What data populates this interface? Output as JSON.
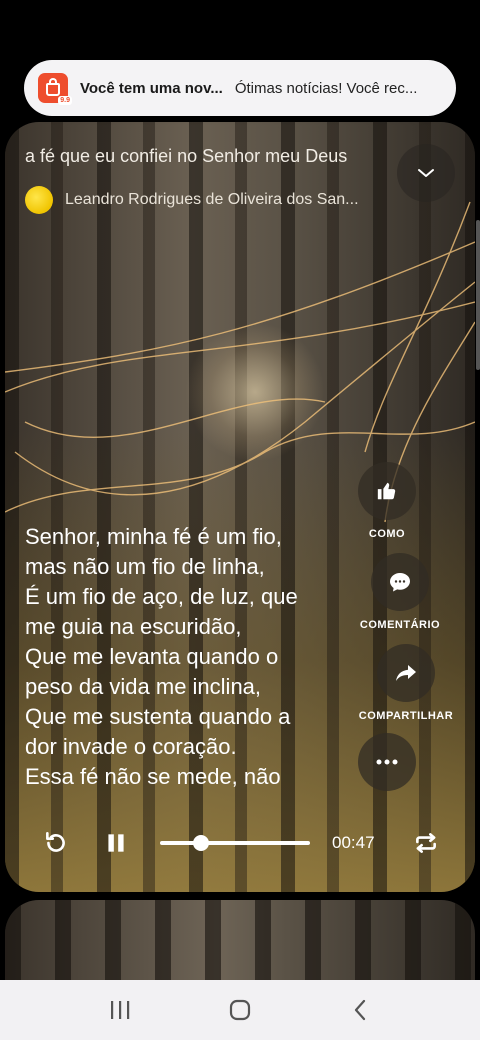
{
  "notification": {
    "app_icon": "shopee-bag-icon",
    "badge": "9.9",
    "title": "Você tem uma nov...",
    "body": "Ótimas notícias! Você rec..."
  },
  "player": {
    "song_title": "a fé que eu confiei no Senhor meu Deus",
    "artist": "Leandro Rodrigues de Oliveira dos San...",
    "collapse_icon": "chevron-down-icon",
    "lyrics": [
      "Senhor, minha fé é um fio,",
      "mas não um fio de linha,",
      "É um fio de aço, de luz, que",
      "me guia na escuridão,",
      "Que me levanta quando o",
      "peso da vida me inclina,",
      "Que me sustenta quando a",
      "dor invade o coração.",
      "Essa fé não se mede, não"
    ],
    "actions": [
      {
        "label": "COMO",
        "icon": "thumbs-up-icon"
      },
      {
        "label": "COMENTÁRIO",
        "icon": "comment-icon"
      },
      {
        "label": "COMPARTILHAR",
        "icon": "share-icon"
      },
      {
        "label": "",
        "icon": "more-icon"
      }
    ],
    "controls": {
      "replay_icon": "replay-icon",
      "pause_icon": "pause-icon",
      "progress_fraction": 0.27,
      "time": "00:47",
      "repeat_icon": "repeat-icon"
    }
  },
  "navbar": {
    "recents_icon": "recents-icon",
    "home_icon": "home-icon",
    "back_icon": "back-icon"
  },
  "colors": {
    "notification_bg": "#f4f3f5",
    "shopee_orange": "#ee4d2d",
    "avatar_yellow": "#f5d000",
    "navbar_bg": "#f2f1f3"
  }
}
